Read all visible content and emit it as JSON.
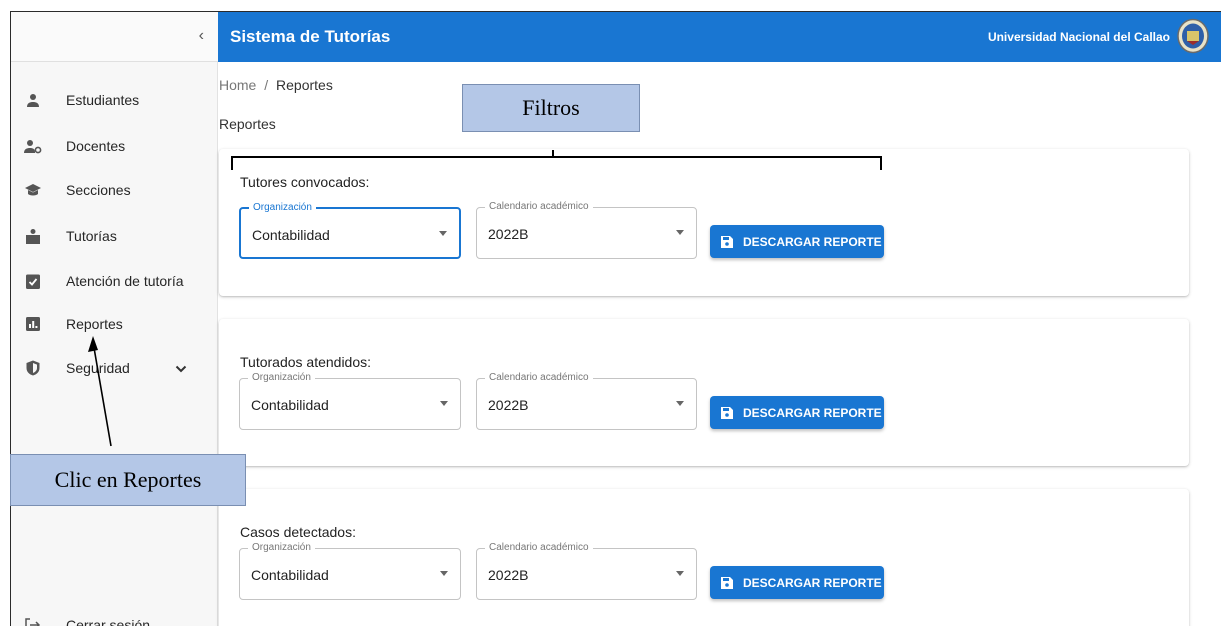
{
  "sidebar": {
    "collapse_icon": "chevron-left-icon",
    "items": [
      {
        "label": "Estudiantes",
        "icon": "person-icon"
      },
      {
        "label": "Docentes",
        "icon": "person-gear-icon"
      },
      {
        "label": "Secciones",
        "icon": "graduation-cap-icon"
      },
      {
        "label": "Tutorías",
        "icon": "teacher-icon"
      },
      {
        "label": "Atención de tutoría",
        "icon": "clipboard-check-icon"
      },
      {
        "label": "Reportes",
        "icon": "bar-chart-icon"
      },
      {
        "label": "Seguridad",
        "icon": "shield-icon",
        "expand_icon": "chevron-down-icon"
      }
    ],
    "logout": {
      "label": "Cerrar sesión",
      "icon": "logout-icon"
    }
  },
  "header": {
    "title": "Sistema de Tutorías",
    "university": "Universidad Nacional del Callao",
    "logo_icon": "university-seal-icon",
    "color": "#1976d2"
  },
  "breadcrumb": {
    "home": "Home",
    "separator": "/",
    "current": "Reportes"
  },
  "page_title": "Reportes",
  "cards": [
    {
      "title": "Tutores convocados:",
      "organization": {
        "legend": "Organización",
        "value": "Contabilidad"
      },
      "calendar": {
        "legend": "Calendario académico",
        "value": "2022B"
      },
      "button": "DESCARGAR REPORTE"
    },
    {
      "title": "Tutorados atendidos:",
      "organization": {
        "legend": "Organización",
        "value": "Contabilidad"
      },
      "calendar": {
        "legend": "Calendario académico",
        "value": "2022B"
      },
      "button": "DESCARGAR REPORTE"
    },
    {
      "title": "Casos detectados:",
      "organization": {
        "legend": "Organización",
        "value": "Contabilidad"
      },
      "calendar": {
        "legend": "Calendario académico",
        "value": "2022B"
      },
      "button": "DESCARGAR REPORTE"
    }
  ],
  "annotations": {
    "filters": "Filtros",
    "click_reports": "Clic en Reportes",
    "color": "#b4c7e7"
  }
}
